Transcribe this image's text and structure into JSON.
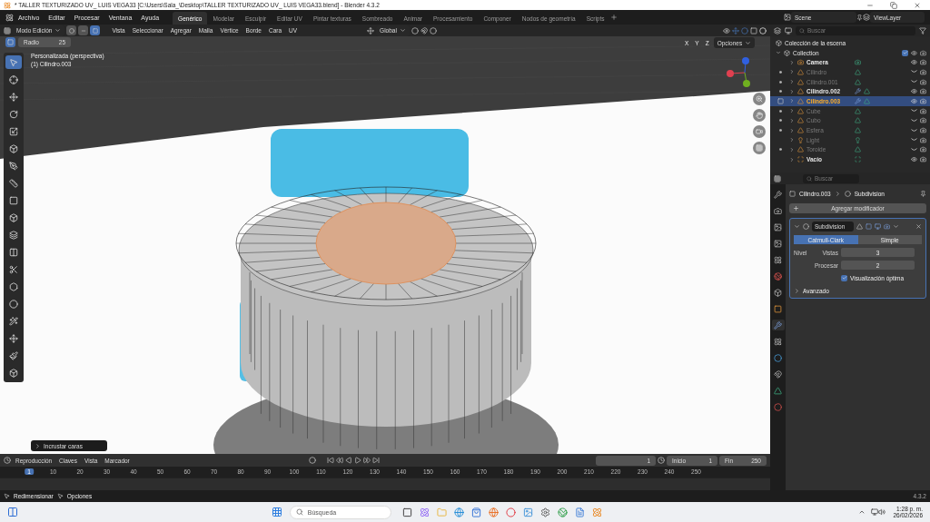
{
  "title_bar": {
    "title": "* TALLER TEXTURIZADO UV_ LUIS VEGA33 [C:\\Users\\Sala_\\Desktop\\TALLER TEXTURIZADO UV_ LUIS VEGA33.blend] - Blender 4.3.2"
  },
  "menu": [
    "Archivo",
    "Editar",
    "Procesar",
    "Ventana",
    "Ayuda"
  ],
  "workspaces": [
    {
      "label": "Genérico",
      "selected": true
    },
    {
      "label": "Modelar",
      "selected": false
    },
    {
      "label": "Esculpir",
      "selected": false
    },
    {
      "label": "Editar UV",
      "selected": false
    },
    {
      "label": "Pintar texturas",
      "selected": false
    },
    {
      "label": "Sombreado",
      "selected": false
    },
    {
      "label": "Animar",
      "selected": false
    },
    {
      "label": "Procesamiento",
      "selected": false
    },
    {
      "label": "Componer",
      "selected": false
    },
    {
      "label": "Nodos de geometría",
      "selected": false
    },
    {
      "label": "Scripts",
      "selected": false
    }
  ],
  "scene": "Scene",
  "view_layer": "ViewLayer",
  "viewport_header": {
    "mode": "Modo Edición",
    "select_modes": [
      {
        "kind": "vertex",
        "selected": false
      },
      {
        "kind": "edge",
        "selected": false
      },
      {
        "kind": "face",
        "selected": true
      }
    ],
    "menus": [
      "Vista",
      "Seleccionar",
      "Agregar",
      "Malla",
      "Vértice",
      "Borde",
      "Cara",
      "UV"
    ],
    "orientation": "Global",
    "axes": [
      "X",
      "Y",
      "Z"
    ],
    "options": "Opciones"
  },
  "tool_settings": {
    "label": "Radio",
    "value": "25"
  },
  "viewport": {
    "view_name": "Personalizada (perspectiva)",
    "object_name": "(1) Cilindro.003",
    "last_operator": "Incrustar caras"
  },
  "outliner": {
    "search_placeholder": "Buscar",
    "root": "Colección de la escena",
    "collection": "Collection",
    "collection_checked": true,
    "items": [
      {
        "name": "Camera",
        "kind": "camera",
        "visible": true,
        "modifier": false,
        "selected": false
      },
      {
        "name": "Cilindro",
        "kind": "mesh",
        "visible": false,
        "modifier": false,
        "selected": false
      },
      {
        "name": "Cilindro.001",
        "kind": "mesh",
        "visible": false,
        "modifier": false,
        "selected": false
      },
      {
        "name": "Cilindro.002",
        "kind": "mesh",
        "visible": true,
        "modifier": true,
        "selected": false
      },
      {
        "name": "Cilindro.003",
        "kind": "mesh",
        "visible": true,
        "modifier": true,
        "selected": true
      },
      {
        "name": "Cube",
        "kind": "mesh",
        "visible": false,
        "modifier": false,
        "selected": false
      },
      {
        "name": "Cubo",
        "kind": "mesh",
        "visible": false,
        "modifier": false,
        "selected": false
      },
      {
        "name": "Esfera",
        "kind": "mesh",
        "visible": false,
        "modifier": false,
        "selected": false
      },
      {
        "name": "Light",
        "kind": "light",
        "visible": false,
        "modifier": false,
        "selected": false
      },
      {
        "name": "Toroide",
        "kind": "mesh",
        "visible": false,
        "modifier": false,
        "selected": false
      },
      {
        "name": "Vacío",
        "kind": "empty",
        "visible": true,
        "modifier": false,
        "selected": false
      }
    ]
  },
  "properties": {
    "search_placeholder": "Buscar",
    "breadcrumb": [
      "Cilindro.003",
      "Subdivision"
    ],
    "add_modifier": "Agregar modificador",
    "modifier": {
      "name": "Subdivision",
      "expanded": true,
      "types": [
        {
          "label": "Catmull-Clark",
          "selected": true
        },
        {
          "label": "Simple",
          "selected": false
        }
      ],
      "level_label": "Nivel",
      "fields": [
        {
          "label": "Vistas",
          "value": "3"
        },
        {
          "label": "Procesar",
          "value": "2"
        }
      ],
      "optimal": {
        "label": "Visualización óptima",
        "checked": true
      },
      "advanced": "Avanzado"
    }
  },
  "timeline": {
    "menus": [
      "Reproducción",
      "Claves",
      "Vista",
      "Marcador"
    ],
    "current": "1",
    "start_label": "Inicio",
    "start": "1",
    "end_label": "Fin",
    "end": "250",
    "ticks": [
      "1",
      "10",
      "20",
      "30",
      "40",
      "50",
      "60",
      "70",
      "80",
      "90",
      "100",
      "110",
      "120",
      "130",
      "140",
      "150",
      "160",
      "170",
      "180",
      "190",
      "200",
      "210",
      "220",
      "230",
      "240",
      "250"
    ]
  },
  "status_bar": {
    "hints": [
      "Redimensionar",
      "Opciones"
    ],
    "version": "4.3.2"
  },
  "taskbar": {
    "search_placeholder": "Búsqueda",
    "time": "1:28 p. m.",
    "date": "26/02/2026"
  }
}
